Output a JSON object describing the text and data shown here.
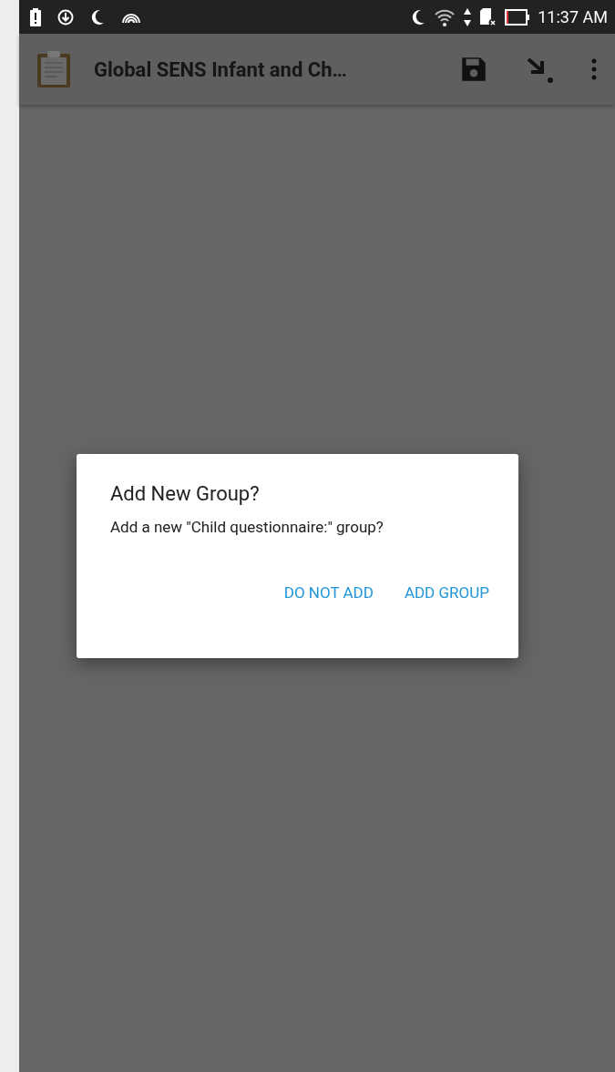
{
  "status_bar": {
    "time": "11:37 AM"
  },
  "toolbar": {
    "title": "Global SENS Infant and Ch…"
  },
  "dialog": {
    "title": "Add New Group?",
    "message": "Add a new \"Child questionnaire:\" group?",
    "buttons": [
      {
        "label": "DO NOT ADD"
      },
      {
        "label": "ADD GROUP"
      }
    ]
  }
}
